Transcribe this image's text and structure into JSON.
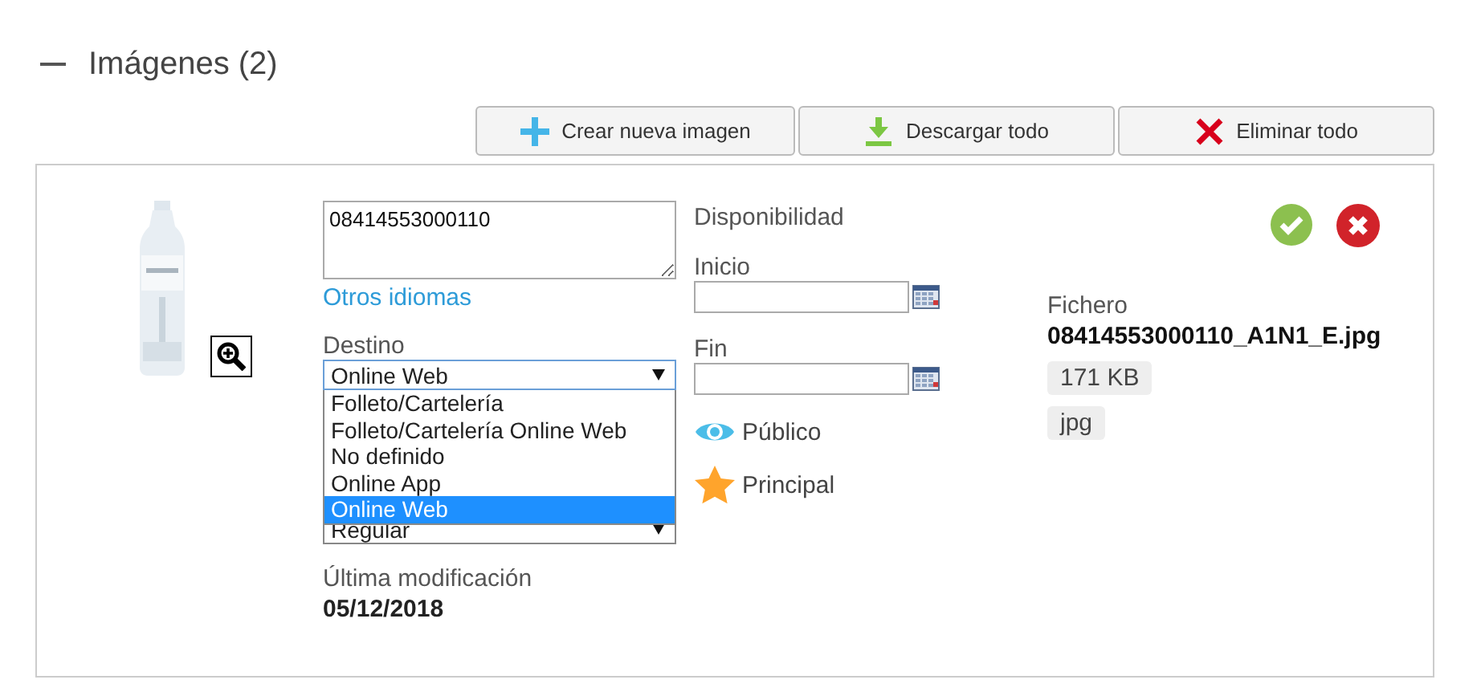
{
  "section": {
    "title": "Imágenes (2)",
    "expanded": true
  },
  "toolbar": [
    {
      "label": "Crear nueva imagen",
      "kind": "create"
    },
    {
      "label": "Descargar todo",
      "kind": "download"
    },
    {
      "label": "Eliminar todo",
      "kind": "delete"
    }
  ],
  "image_card": {
    "description": "08414553000110",
    "other_languages_link": "Otros idiomas",
    "destination": {
      "label": "Destino",
      "value": "Online Web",
      "expanded": true,
      "options": [
        {
          "label": "Folleto/Cartelería",
          "selected": false
        },
        {
          "label": "Folleto/Cartelería Online Web",
          "selected": false
        },
        {
          "label": "No definido",
          "selected": false
        },
        {
          "label": "Online App",
          "selected": false
        },
        {
          "label": "Online Web",
          "selected": true
        }
      ]
    },
    "second_select": {
      "value": "Regular"
    },
    "last_modified": {
      "label": "Última modificación",
      "value": "05/12/2018"
    },
    "availability": {
      "title": "Disponibilidad",
      "start": {
        "label": "Inicio"
      },
      "end": {
        "label": "Fin"
      }
    },
    "flags": [
      {
        "label": "Público",
        "kind": "public"
      },
      {
        "label": "Principal",
        "kind": "main"
      }
    ],
    "file": {
      "label": "Fichero",
      "name": "08414553000110_A1N1_E.jpg",
      "tags": [
        "171 KB",
        "jpg"
      ]
    }
  }
}
